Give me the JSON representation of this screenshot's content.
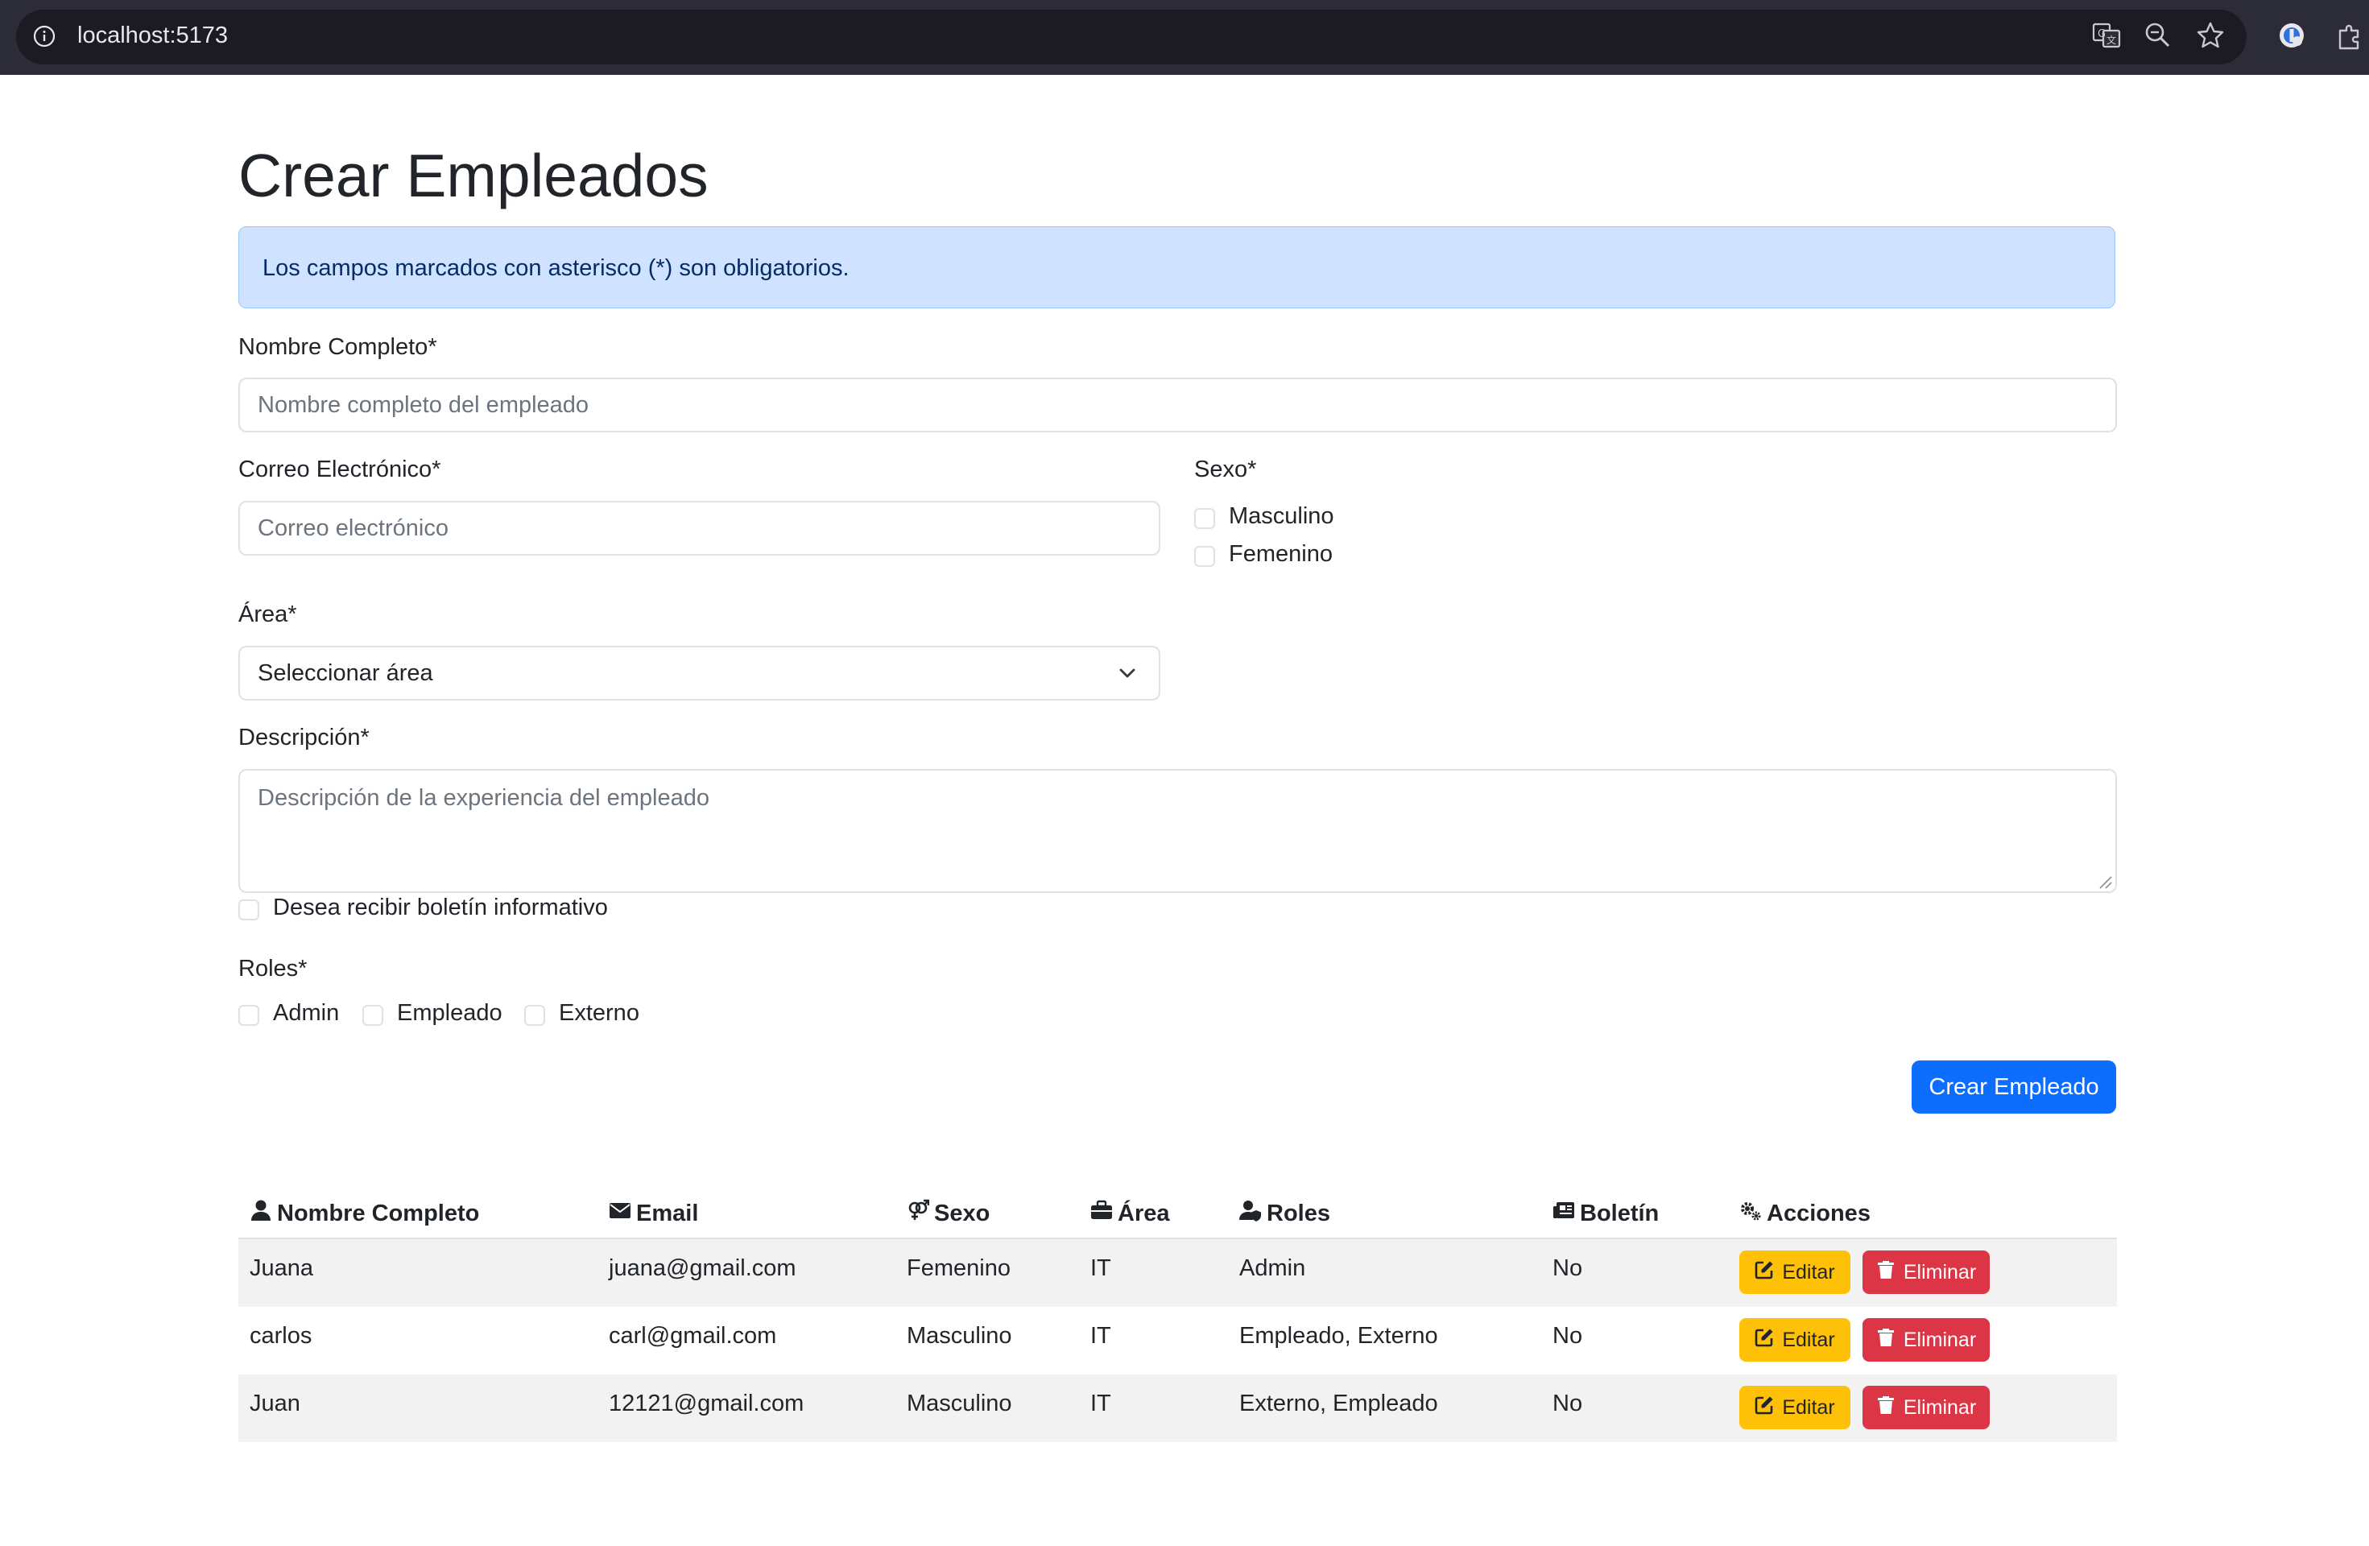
{
  "browser": {
    "url": "localhost:5173",
    "icons": [
      "info-icon",
      "translate-icon",
      "zoom-icon",
      "star-icon",
      "extension-account-icon",
      "puzzle-icon"
    ]
  },
  "page": {
    "title": "Crear Empleados",
    "alert": "Los campos marcados con asterisco (*) son obligatorios."
  },
  "form": {
    "name_label": "Nombre Completo*",
    "name_placeholder": "Nombre completo del empleado",
    "email_label": "Correo Electrónico*",
    "email_placeholder": "Correo electrónico",
    "sex_label": "Sexo*",
    "sex_options": [
      "Masculino",
      "Femenino"
    ],
    "area_label": "Área*",
    "area_selected": "Seleccionar área",
    "description_label": "Descripción*",
    "description_placeholder": "Descripción de la experiencia del empleado",
    "newsletter_label": "Desea recibir boletín informativo",
    "roles_label": "Roles*",
    "roles_options": [
      "Admin",
      "Empleado",
      "Externo"
    ],
    "submit_label": "Crear Empleado"
  },
  "table": {
    "headers": [
      "Nombre Completo",
      "Email",
      "Sexo",
      "Área",
      "Roles",
      "Boletín",
      "Acciones"
    ],
    "header_icons": [
      "user-icon",
      "envelope-icon",
      "venus-mars-icon",
      "briefcase-icon",
      "user-shield-icon",
      "newspaper-icon",
      "gears-icon"
    ],
    "edit_label": "Editar",
    "delete_label": "Eliminar",
    "rows": [
      {
        "name": "Juana",
        "email": "juana@gmail.com",
        "sex": "Femenino",
        "area": "IT",
        "roles": "Admin",
        "newsletter": "No"
      },
      {
        "name": "carlos",
        "email": "carl@gmail.com",
        "sex": "Masculino",
        "area": "IT",
        "roles": "Empleado, Externo",
        "newsletter": "No"
      },
      {
        "name": "Juan",
        "email": "12121@gmail.com",
        "sex": "Masculino",
        "area": "IT",
        "roles": "Externo, Empleado",
        "newsletter": "No"
      }
    ]
  },
  "colors": {
    "primary": "#0d6efd",
    "warning": "#ffc107",
    "danger": "#dc3545",
    "alert_bg": "#cfe2ff",
    "chrome_bg": "#2c2b38"
  }
}
